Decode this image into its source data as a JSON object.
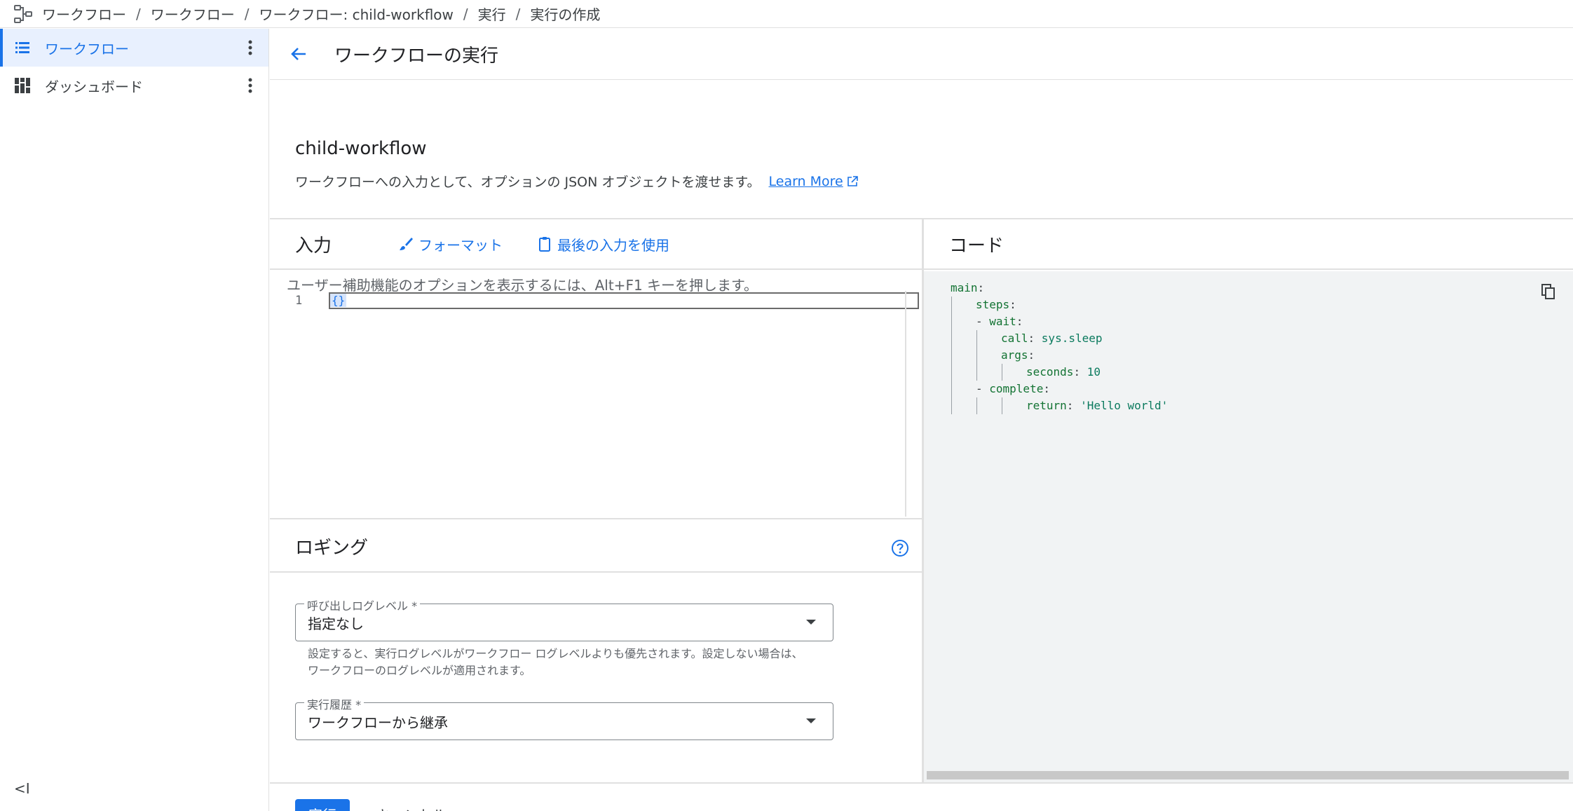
{
  "breadcrumb": {
    "items": [
      "ワークフロー",
      "ワークフロー",
      "ワークフロー: child-workflow",
      "実行",
      "実行の作成"
    ],
    "separator": "/"
  },
  "sidebar": {
    "items": [
      {
        "label": "ワークフロー",
        "icon": "list-icon",
        "active": true
      },
      {
        "label": "ダッシュボード",
        "icon": "dashboard-icon",
        "active": false
      }
    ],
    "collapse_label": "<I"
  },
  "header": {
    "title": "ワークフローの実行"
  },
  "workflow": {
    "name": "child-workflow",
    "description": "ワークフローへの入力として、オプションの JSON オブジェクトを渡せます。",
    "learn_more": "Learn More"
  },
  "input_panel": {
    "title": "入力",
    "format_label": "フォーマット",
    "use_last_label": "最後の入力を使用",
    "a11y_hint": "ユーザー補助機能のオプションを表示するには、Alt+F1 キーを押します。",
    "line_number": "1",
    "value": "{}"
  },
  "logging": {
    "title": "ロギング",
    "call_log_level": {
      "label": "呼び出しログレベル *",
      "value": "指定なし",
      "hint": "設定すると、実行ログレベルがワークフロー ログレベルよりも優先されます。設定しない場合は、ワークフローのログレベルが適用されます。"
    },
    "history": {
      "label": "実行履歴 *",
      "value": "ワークフローから継承"
    }
  },
  "code_panel": {
    "title": "コード",
    "lines": [
      {
        "indent": 0,
        "key": "main",
        "sep": ":",
        "value": "",
        "dash": false
      },
      {
        "indent": 1,
        "key": "steps",
        "sep": ":",
        "value": "",
        "dash": false
      },
      {
        "indent": 1,
        "key": "wait",
        "sep": ":",
        "value": "",
        "dash": true
      },
      {
        "indent": 2,
        "key": "call",
        "sep": ": ",
        "value": "sys.sleep",
        "dash": false
      },
      {
        "indent": 2,
        "key": "args",
        "sep": ":",
        "value": "",
        "dash": false
      },
      {
        "indent": 3,
        "key": "seconds",
        "sep": ": ",
        "value": "10",
        "dash": false
      },
      {
        "indent": 1,
        "key": "complete",
        "sep": ":",
        "value": "",
        "dash": true
      },
      {
        "indent": 3,
        "key": "return",
        "sep": ": ",
        "value": "'Hello world'",
        "dash": false
      }
    ]
  },
  "footer": {
    "run_label": "実行",
    "cancel_label": "キャンセル"
  },
  "colors": {
    "accent": "#1a73e8",
    "active_bg": "#e8f0fe",
    "code_bg": "#f1f3f4"
  }
}
